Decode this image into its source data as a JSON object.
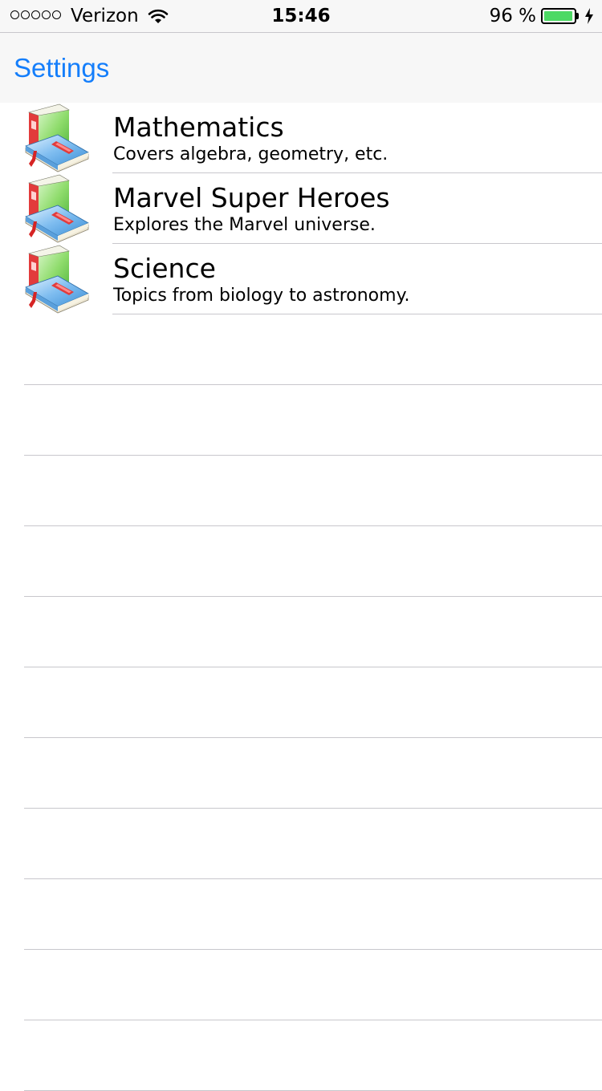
{
  "status_bar": {
    "carrier": "Verizon",
    "time": "15:46",
    "battery_percent": "96 %",
    "battery_level": 0.96,
    "signal_icon": "signal-dots-icon",
    "wifi_icon": "wifi-icon",
    "battery_icon": "battery-icon",
    "charging_icon": "charging-bolt-icon"
  },
  "nav_bar": {
    "back_label": "Settings"
  },
  "colors": {
    "accent": "#147efb",
    "separator": "#c8c7cc",
    "battery": "#4cd964",
    "bar_background": "#f7f7f7"
  },
  "list": {
    "item_icon": "book-icon",
    "items": [
      {
        "title": "Mathematics",
        "subtitle": "Covers algebra, geometry, etc."
      },
      {
        "title": "Marvel Super Heroes",
        "subtitle": "Explores the Marvel universe."
      },
      {
        "title": "Science",
        "subtitle": "Topics from biology to astronomy."
      }
    ]
  }
}
